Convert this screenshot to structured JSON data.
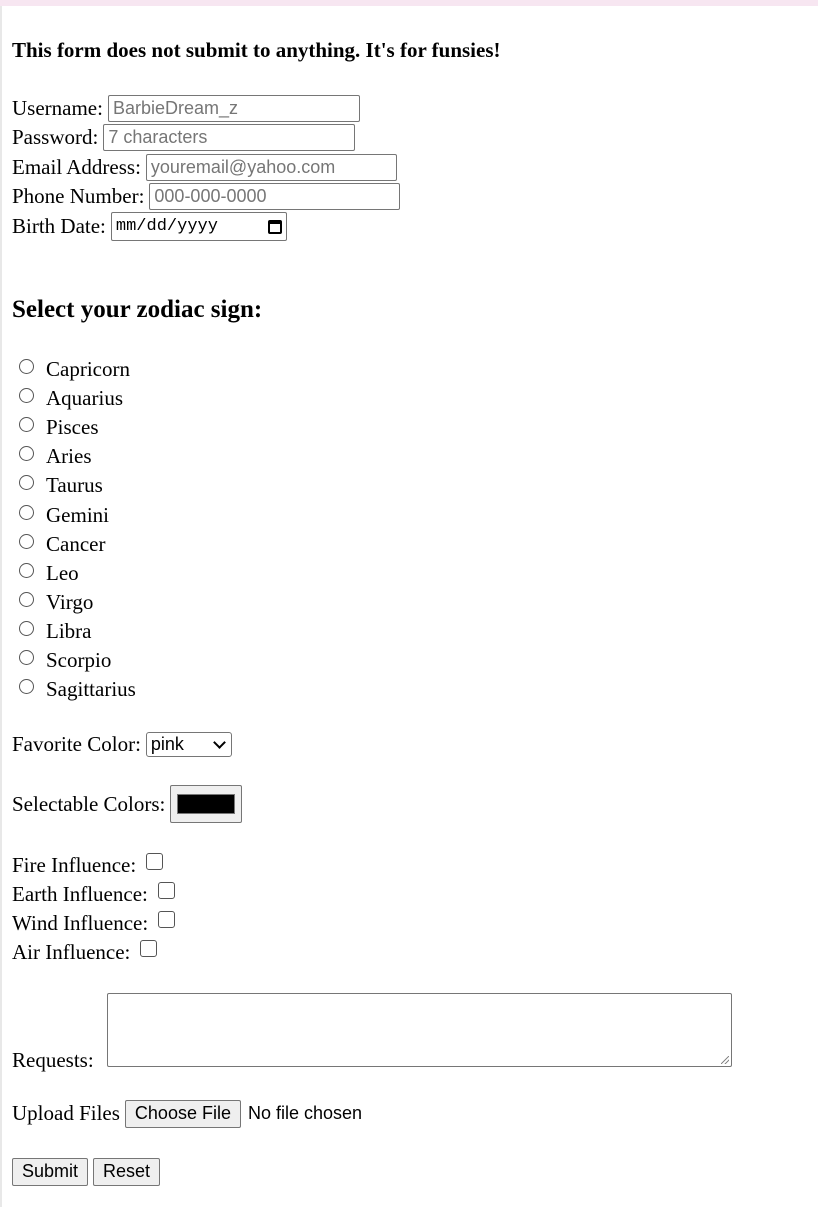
{
  "notice": "This form does not submit to anything. It's for funsies!",
  "fields": {
    "username": {
      "label": "Username:",
      "placeholder": "BarbieDream_z"
    },
    "password": {
      "label": "Password:",
      "placeholder": "7 characters"
    },
    "email": {
      "label": "Email Address:",
      "placeholder": "youremail@yahoo.com"
    },
    "phone": {
      "label": "Phone Number:",
      "placeholder": "000-000-0000"
    },
    "birth_date": {
      "label": "Birth Date:",
      "placeholder": "mm/dd/yyyy",
      "icon": "calendar-icon"
    }
  },
  "zodiac": {
    "title": "Select your zodiac sign:",
    "options": [
      "Capricorn",
      "Aquarius",
      "Pisces",
      "Aries",
      "Taurus",
      "Gemini",
      "Cancer",
      "Leo",
      "Virgo",
      "Libra",
      "Scorpio",
      "Sagittarius"
    ]
  },
  "favorite_color": {
    "label": "Favorite Color:",
    "value": "pink",
    "icon": "chevron-down-icon"
  },
  "selectable_colors": {
    "label": "Selectable Colors:",
    "value": "#000000"
  },
  "influences": [
    {
      "label": "Fire Influence:",
      "checked": false
    },
    {
      "label": "Earth Influence:",
      "checked": false
    },
    {
      "label": "Wind Influence:",
      "checked": false
    },
    {
      "label": "Air Influence:",
      "checked": false
    }
  ],
  "requests": {
    "label": "Requests:",
    "value": ""
  },
  "upload": {
    "label": "Upload Files",
    "button": "Choose File",
    "status": "No file chosen"
  },
  "actions": {
    "submit": "Submit",
    "reset": "Reset"
  },
  "colors": {
    "top_bar": "#f7e6f1"
  }
}
